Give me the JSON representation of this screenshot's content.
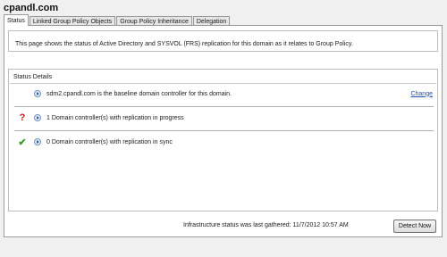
{
  "header": {
    "title": "cpandl.com"
  },
  "tabs": [
    {
      "label": "Status",
      "active": true
    },
    {
      "label": "Linked Group Policy Objects",
      "active": false
    },
    {
      "label": "Group Policy Inheritance",
      "active": false
    },
    {
      "label": "Delegation",
      "active": false
    }
  ],
  "info": {
    "text": "This page shows the status of Active Directory and SYSVOL (FRS) replication for this domain as it relates to Group Policy."
  },
  "status_details": {
    "title": "Status Details",
    "baseline": {
      "text": "sdm2.cpandl.com is the baseline domain controller for this domain.",
      "change_label": "Change"
    },
    "in_progress": {
      "icon": "question-mark-icon",
      "text": "1 Domain controller(s) with replication in progress"
    },
    "in_sync": {
      "icon": "checkmark-icon",
      "text": "0 Domain controller(s) with replication in sync"
    }
  },
  "footer": {
    "last_gathered": "Infrastructure status was last gathered: 11/7/2012 10:57 AM",
    "detect_button": "Detect Now"
  },
  "colors": {
    "question_icon": "#c62020",
    "check_icon": "#3a9a2a",
    "link": "#1a4fb5"
  }
}
